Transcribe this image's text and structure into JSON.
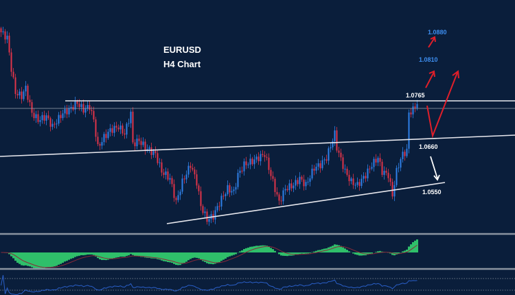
{
  "chart_data": {
    "type": "candlestick",
    "title": "EURUSD",
    "subtitle": "H4 Chart",
    "colors": {
      "background": "#0a1e3b",
      "up": "#2f80e8",
      "down": "#e0344a",
      "target_label": "#3d8ef0",
      "level_label": "#ffffff",
      "projection": "#e01f2a",
      "macd_hist": "#2fbf6a",
      "macd_signal": "#8a2a3a",
      "rsi": "#2a5fc8"
    },
    "price_path": [
      [
        0,
        1.094
      ],
      [
        3,
        1.0926
      ],
      [
        5,
        1.0847
      ],
      [
        7,
        1.0786
      ],
      [
        10,
        1.0777
      ],
      [
        12,
        1.0798
      ],
      [
        15,
        1.0734
      ],
      [
        18,
        1.0716
      ],
      [
        22,
        1.0725
      ],
      [
        25,
        1.0699
      ],
      [
        30,
        1.0734
      ],
      [
        33,
        1.0742
      ],
      [
        37,
        1.076
      ],
      [
        40,
        1.0742
      ],
      [
        43,
        1.0751
      ],
      [
        45,
        1.0716
      ],
      [
        47,
        1.0646
      ],
      [
        50,
        1.0672
      ],
      [
        53,
        1.069
      ],
      [
        57,
        1.0699
      ],
      [
        60,
        1.0681
      ],
      [
        63,
        1.0734
      ],
      [
        64,
        1.0655
      ],
      [
        67,
        1.0664
      ],
      [
        70,
        1.0646
      ],
      [
        75,
        1.0629
      ],
      [
        78,
        1.0585
      ],
      [
        82,
        1.0567
      ],
      [
        85,
        1.0506
      ],
      [
        88,
        1.0558
      ],
      [
        92,
        1.0602
      ],
      [
        95,
        1.0558
      ],
      [
        97,
        1.0497
      ],
      [
        100,
        1.0462
      ],
      [
        103,
        1.0471
      ],
      [
        107,
        1.0515
      ],
      [
        110,
        1.0541
      ],
      [
        113,
        1.0532
      ],
      [
        115,
        1.0576
      ],
      [
        118,
        1.0602
      ],
      [
        122,
        1.0611
      ],
      [
        125,
        1.062
      ],
      [
        128,
        1.0629
      ],
      [
        132,
        1.0558
      ],
      [
        135,
        1.0506
      ],
      [
        138,
        1.0541
      ],
      [
        142,
        1.055
      ],
      [
        145,
        1.0567
      ],
      [
        148,
        1.055
      ],
      [
        152,
        1.0594
      ],
      [
        155,
        1.0602
      ],
      [
        158,
        1.062
      ],
      [
        162,
        1.0681
      ],
      [
        163,
        1.0646
      ],
      [
        167,
        1.0585
      ],
      [
        170,
        1.0558
      ],
      [
        173,
        1.055
      ],
      [
        177,
        1.0576
      ],
      [
        180,
        1.0602
      ],
      [
        183,
        1.062
      ],
      [
        185,
        1.0585
      ],
      [
        188,
        1.0576
      ],
      [
        190,
        1.0524
      ],
      [
        192,
        1.0585
      ],
      [
        193,
        1.0602
      ],
      [
        195,
        1.0629
      ],
      [
        197,
        1.0637
      ],
      [
        198,
        1.0734
      ],
      [
        200,
        1.0742
      ],
      [
        202,
        1.076
      ]
    ],
    "levels": [
      {
        "label": "1.0880",
        "price": 1.088,
        "kind": "target"
      },
      {
        "label": "1.0810",
        "price": 1.081,
        "kind": "target"
      },
      {
        "label": "1.0765",
        "price": 1.0765,
        "kind": "resistance"
      },
      {
        "label": "1.0660",
        "price": 1.066,
        "kind": "support"
      },
      {
        "label": "1.0550",
        "price": 1.055,
        "kind": "support"
      }
    ]
  }
}
